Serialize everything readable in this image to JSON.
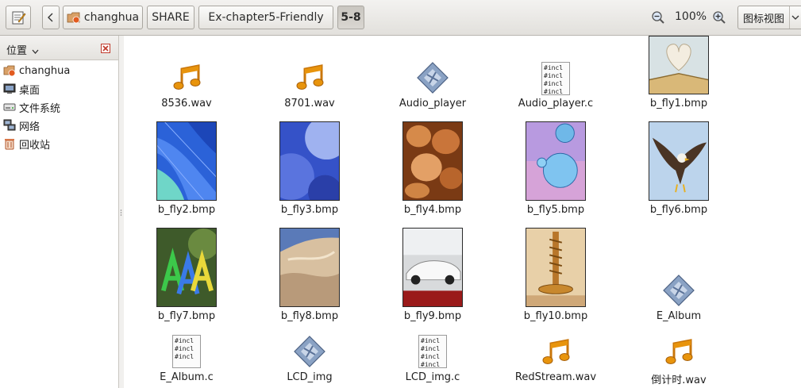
{
  "toolbar": {
    "path": [
      "changhua",
      "SHARE",
      "Ex-chapter5-Friendly",
      "5-8"
    ],
    "zoom": "100%",
    "view_mode": "图标视图"
  },
  "sidebar": {
    "title": "位置",
    "items": [
      {
        "label": "changhua",
        "icon": "home-folder-icon"
      },
      {
        "label": "桌面",
        "icon": "desktop-icon"
      },
      {
        "label": "文件系统",
        "icon": "drive-icon"
      },
      {
        "label": "网络",
        "icon": "network-icon"
      },
      {
        "label": "回收站",
        "icon": "trash-icon"
      }
    ]
  },
  "files": [
    {
      "name": "8536.wav",
      "icon": "audio-file-icon"
    },
    {
      "name": "8701.wav",
      "icon": "audio-file-icon"
    },
    {
      "name": "Audio_player",
      "icon": "executable-icon"
    },
    {
      "name": "Audio_player.c",
      "icon": "c-source-icon"
    },
    {
      "name": "b_fly1.bmp",
      "icon": "image-thumbnail-book-heart"
    },
    {
      "name": "b_fly2.bmp",
      "icon": "image-thumbnail-blue-abstract"
    },
    {
      "name": "b_fly3.bmp",
      "icon": "image-thumbnail-blue-spheres"
    },
    {
      "name": "b_fly4.bmp",
      "icon": "image-thumbnail-clay-pots"
    },
    {
      "name": "b_fly5.bmp",
      "icon": "image-thumbnail-bubbles"
    },
    {
      "name": "b_fly6.bmp",
      "icon": "image-thumbnail-eagle"
    },
    {
      "name": "b_fly7.bmp",
      "icon": "image-thumbnail-letters"
    },
    {
      "name": "b_fly8.bmp",
      "icon": "image-thumbnail-dunes"
    },
    {
      "name": "b_fly9.bmp",
      "icon": "image-thumbnail-car"
    },
    {
      "name": "b_fly10.bmp",
      "icon": "image-thumbnail-screw"
    },
    {
      "name": "E_Album",
      "icon": "executable-icon"
    },
    {
      "name": "E_Album.c",
      "icon": "c-source-icon"
    },
    {
      "name": "LCD_img",
      "icon": "executable-icon"
    },
    {
      "name": "LCD_img.c",
      "icon": "c-source-icon"
    },
    {
      "name": "RedStream.wav",
      "icon": "audio-file-icon"
    },
    {
      "name": "倒计时.wav",
      "icon": "audio-file-icon"
    }
  ],
  "c_source_preview_line": "#incl",
  "colors": {
    "toolbar_bg": "#e8e6e2",
    "music_note": "#e8940c",
    "executable": "#7f97b9"
  }
}
